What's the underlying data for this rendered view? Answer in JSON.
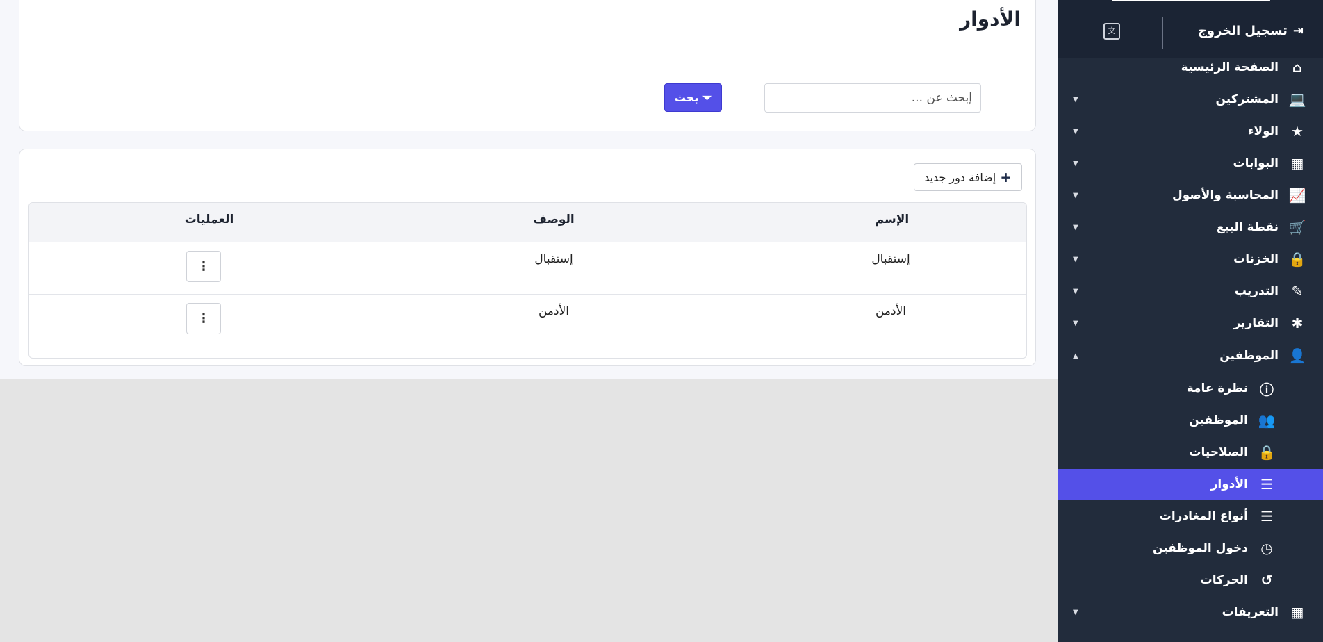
{
  "page": {
    "title": "الأدوار",
    "search": {
      "placeholder": "إبحث عن ...",
      "value": ""
    },
    "search_button": "بحث",
    "add_button": "إضافة دور جديد"
  },
  "table": {
    "headers": [
      "الإسم",
      "الوصف",
      "العمليات"
    ],
    "rows": [
      {
        "name": "إستقبال",
        "description": "إستقبال"
      },
      {
        "name": "الأدمن",
        "description": "الأدمن"
      }
    ]
  },
  "sidebar": {
    "logout": "تسجيل الخروج",
    "items": [
      {
        "label": "الصفحة الرئيسية",
        "icon": "home-icon",
        "glyph": "⌂"
      },
      {
        "label": "المشتركين",
        "icon": "laptop-icon",
        "glyph": "💻",
        "caret": "▼"
      },
      {
        "label": "الولاء",
        "icon": "star-icon",
        "glyph": "★",
        "caret": "▼"
      },
      {
        "label": "البوابات",
        "icon": "building-icon",
        "glyph": "▦",
        "caret": "▼"
      },
      {
        "label": "المحاسبة والأصول",
        "icon": "chart-line-icon",
        "glyph": "📈",
        "caret": "▼"
      },
      {
        "label": "نقطة البيع",
        "icon": "cart-icon",
        "glyph": "🛒",
        "caret": "▼"
      },
      {
        "label": "الخزنات",
        "icon": "lock-icon",
        "glyph": "🔒",
        "caret": "▼"
      },
      {
        "label": "التدريب",
        "icon": "magic-wand-icon",
        "glyph": "✎",
        "caret": "▼"
      },
      {
        "label": "التقارير",
        "icon": "bug-icon",
        "glyph": "✱",
        "caret": "▼"
      },
      {
        "label": "الموظفين",
        "icon": "user-icon",
        "glyph": "👤",
        "caret": "▲"
      },
      {
        "label": "نظرة عامة",
        "icon": "info-icon",
        "glyph": "ⓘ",
        "sub": true
      },
      {
        "label": "الموظفين",
        "icon": "users-icon",
        "glyph": "👥",
        "sub": true
      },
      {
        "label": "الصلاحيات",
        "icon": "lock-icon",
        "glyph": "🔒",
        "sub": true
      },
      {
        "label": "الأدوار",
        "icon": "list-icon",
        "glyph": "☰",
        "sub": true,
        "active": true
      },
      {
        "label": "أنواع المغادرات",
        "icon": "list-icon",
        "glyph": "☰",
        "sub": true
      },
      {
        "label": "دخول الموظفين",
        "icon": "clock-icon",
        "glyph": "◷",
        "sub": true
      },
      {
        "label": "الحركات",
        "icon": "history-icon",
        "glyph": "↺",
        "sub": true
      },
      {
        "label": "التعريفات",
        "icon": "table-icon",
        "glyph": "▦",
        "caret": "▼"
      }
    ]
  },
  "colors": {
    "accent": "#5450e8",
    "sidebar_bg": "#222c3c"
  }
}
